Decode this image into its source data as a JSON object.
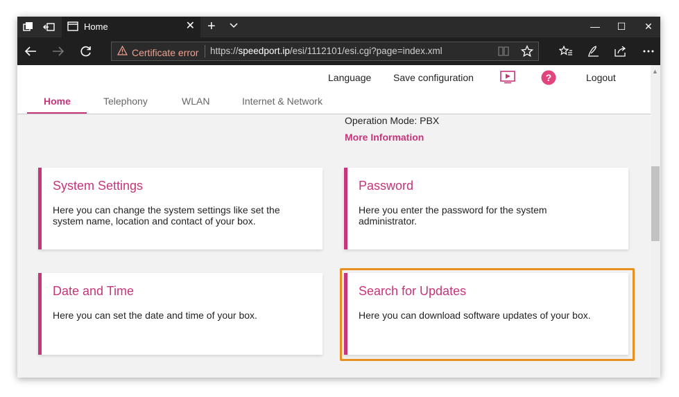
{
  "browser": {
    "tab_title": "Home",
    "address": {
      "cert_label": "Certificate error",
      "url_prefix": "https://",
      "url_host": "speedport.ip",
      "url_path": "/esi/1112101/esi.cgi?page=index.xml"
    }
  },
  "site": {
    "utility_nav": {
      "language": "Language",
      "save": "Save configuration",
      "logout": "Logout"
    },
    "main_nav": [
      "Home",
      "Telephony",
      "WLAN",
      "Internet & Network"
    ],
    "active_nav": "Home",
    "operation_mode": "Operation Mode: PBX",
    "more_info": "More Information",
    "cards": [
      {
        "title": "System Settings",
        "desc": "Here you can change the system settings like set the system name, location and contact of your box."
      },
      {
        "title": "Password",
        "desc": "Here you enter the password for the system administrator."
      },
      {
        "title": "Date and Time",
        "desc": "Here you can set the date and time of your box."
      },
      {
        "title": "Search for Updates",
        "desc": "Here you can download software updates of your box."
      }
    ],
    "highlighted_card": "Search for Updates"
  },
  "colors": {
    "accent": "#c6357a",
    "highlight": "#e8901f",
    "titlebar": "#2b2b2b",
    "cert_text": "#f0a090"
  },
  "icons": [
    "tab-actions-icon",
    "tab-aside-icon",
    "page-icon",
    "close-icon",
    "new-tab-icon",
    "chevron-down-icon",
    "back-icon",
    "forward-icon",
    "refresh-icon",
    "warning-icon",
    "reading-view-icon",
    "favorite-star-icon",
    "favorites-hub-icon",
    "pen-icon",
    "share-icon",
    "more-icon",
    "video-icon",
    "help-icon"
  ]
}
